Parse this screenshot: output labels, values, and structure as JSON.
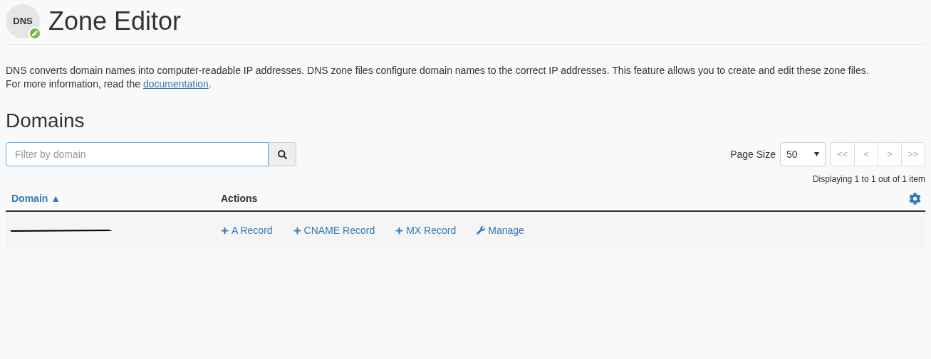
{
  "header": {
    "icon_text": "DNS",
    "title": "Zone Editor"
  },
  "description": {
    "text": "DNS converts domain names into computer-readable IP addresses. DNS zone files configure domain names to the correct IP addresses. This feature allows you to create and edit these zone files.",
    "more_prefix": "For more information, read the ",
    "link": "documentation",
    "more_suffix": "."
  },
  "section_title": "Domains",
  "search": {
    "placeholder": "Filter by domain"
  },
  "page_size": {
    "label": "Page Size",
    "value": "50"
  },
  "pagination": [
    {
      "label": "<<",
      "disabled": true
    },
    {
      "label": "<",
      "disabled": true
    },
    {
      "label": ">",
      "disabled": true
    },
    {
      "label": ">>",
      "disabled": true
    }
  ],
  "displaying": "Displaying 1 to 1 out of 1 item",
  "table": {
    "columns": [
      {
        "label": "Domain",
        "sort": "▲"
      },
      {
        "label": "Actions"
      }
    ],
    "rows": [
      {
        "domain_redacted": true,
        "actions": [
          {
            "kind": "add",
            "label": "A Record"
          },
          {
            "kind": "add",
            "label": "CNAME Record"
          },
          {
            "kind": "add",
            "label": "MX Record"
          },
          {
            "kind": "manage",
            "label": "Manage"
          }
        ]
      }
    ]
  }
}
